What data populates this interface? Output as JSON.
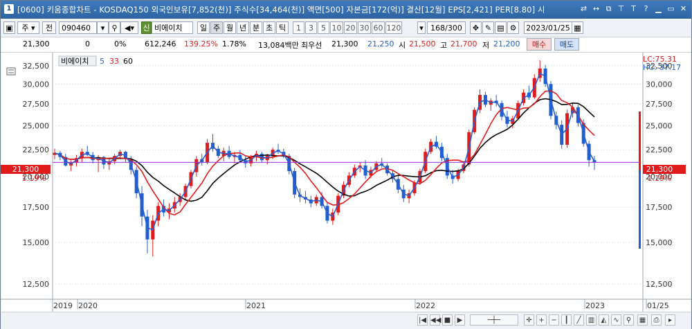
{
  "title": {
    "window_number": "1",
    "text": "[0600] 키움종합차트 - KOSDAQ150 외국인보유[7,852(천)] 주식수[34,464(천)] 액면[500] 자본금[172(억)] 결산[12월] EPS[2,421] PER[8.80] 시"
  },
  "toolbar": {
    "period_select": "주",
    "prev_label": "전",
    "code": "090460",
    "stock_badge": "신",
    "stock_name": "비에이치",
    "period_tabs": [
      "일",
      "주",
      "월",
      "년",
      "분",
      "초",
      "틱"
    ],
    "active_tab": "주",
    "num_tabs": [
      "1",
      "3",
      "5",
      "10",
      "20",
      "30",
      "60",
      "120"
    ],
    "count": "168",
    "count_total": "/300",
    "date": "2023/01/25"
  },
  "quote": {
    "price": "21,300",
    "change": "0",
    "change_pct": "0%",
    "volume": "612,246",
    "volume_ratio": "139.25%",
    "turnover": "1.78%",
    "amount": "13,084백만",
    "bid_label": "최우선",
    "bid1": "21,300",
    "bid2": "21,250",
    "open_label": "시",
    "open": "21,500",
    "high_label": "고",
    "high": "21,700",
    "low_label": "저",
    "low": "21,200",
    "buy_label": "매수",
    "sell_label": "매도"
  },
  "legend": {
    "name": "비에이치",
    "ma1": "5",
    "ma2": "33",
    "ma3": "60"
  },
  "right_labels": {
    "lc": "LC:75.31",
    "hc": "HC:-37.17",
    "price_tag": "21,300",
    "pct_tag": "1.19%"
  },
  "left_labels": {
    "price_tag": "21,300",
    "pct_tag": "1.19%"
  },
  "colors": {
    "ma5": "#2a5fd1",
    "ma33": "#e01b1b",
    "ma60": "#000000",
    "up": "#e01b1b",
    "down": "#1f5fd1",
    "line": "#9b2ad6"
  },
  "chart_data": {
    "type": "candlestick",
    "y_ticks": [
      "32,500",
      "30,000",
      "27,500",
      "25,000",
      "22,500",
      "20,000",
      "17,500",
      "15,000",
      "12,500"
    ],
    "y_values": [
      32500,
      30000,
      27500,
      25000,
      22500,
      20000,
      17500,
      15000,
      12500
    ],
    "x_labels": [
      "2019",
      "2020",
      "2021",
      "2022",
      "2023",
      "01/25"
    ],
    "current_price": 21300,
    "ohlc_weekly_approx": [
      [
        22000,
        22600,
        21600,
        22200
      ],
      [
        22200,
        22400,
        21500,
        21800
      ],
      [
        21800,
        22100,
        20900,
        21000
      ],
      [
        21000,
        21500,
        20500,
        21300
      ],
      [
        21300,
        22000,
        20900,
        21700
      ],
      [
        21700,
        22600,
        21300,
        22300
      ],
      [
        22300,
        22900,
        21900,
        22000
      ],
      [
        22000,
        22300,
        21200,
        21500
      ],
      [
        21500,
        22000,
        20400,
        21800
      ],
      [
        21800,
        21900,
        20700,
        21100
      ],
      [
        21100,
        21600,
        20600,
        21400
      ],
      [
        21400,
        22100,
        21100,
        21900
      ],
      [
        21900,
        22500,
        21600,
        22300
      ],
      [
        22300,
        22400,
        21300,
        21600
      ],
      [
        21600,
        21900,
        20200,
        20600
      ],
      [
        20600,
        20900,
        18200,
        18600
      ],
      [
        18600,
        19200,
        16100,
        16800
      ],
      [
        16800,
        17300,
        14300,
        15200
      ],
      [
        15200,
        16900,
        14100,
        16500
      ],
      [
        16500,
        17900,
        16100,
        17600
      ],
      [
        17600,
        18100,
        16800,
        17100
      ],
      [
        17100,
        17800,
        16600,
        17400
      ],
      [
        17400,
        18300,
        17100,
        17900
      ],
      [
        17900,
        18600,
        17600,
        18300
      ],
      [
        18300,
        19400,
        18000,
        19200
      ],
      [
        19200,
        20600,
        19000,
        20400
      ],
      [
        20400,
        21900,
        20000,
        21600
      ],
      [
        21600,
        22100,
        21000,
        21300
      ],
      [
        21300,
        23600,
        21100,
        23200
      ],
      [
        23200,
        24100,
        22300,
        22600
      ],
      [
        22600,
        22900,
        21700,
        21900
      ],
      [
        21900,
        22700,
        21400,
        22400
      ],
      [
        22400,
        22900,
        21600,
        21800
      ],
      [
        21800,
        22300,
        21200,
        22000
      ],
      [
        22000,
        22500,
        21300,
        21500
      ],
      [
        21500,
        21900,
        20800,
        21200
      ],
      [
        21200,
        22000,
        20900,
        21800
      ],
      [
        21800,
        22400,
        21400,
        22100
      ],
      [
        22100,
        22300,
        21300,
        21500
      ],
      [
        21500,
        22100,
        21100,
        21900
      ],
      [
        21900,
        22700,
        21600,
        22500
      ],
      [
        22500,
        23100,
        22100,
        22300
      ],
      [
        22300,
        22600,
        21700,
        21900
      ],
      [
        21900,
        22100,
        20200,
        20500
      ],
      [
        20500,
        20800,
        18200,
        18500
      ],
      [
        18500,
        19000,
        17900,
        18300
      ],
      [
        18300,
        18800,
        17800,
        18100
      ],
      [
        18100,
        18400,
        17500,
        17800
      ],
      [
        17800,
        18500,
        17600,
        18300
      ],
      [
        18300,
        18700,
        17400,
        17600
      ],
      [
        17600,
        17900,
        16300,
        16500
      ],
      [
        16500,
        17400,
        16200,
        17100
      ],
      [
        17100,
        18600,
        16900,
        18400
      ],
      [
        18400,
        19600,
        18200,
        19300
      ],
      [
        19300,
        20400,
        19100,
        20100
      ],
      [
        20100,
        21100,
        19900,
        20800
      ],
      [
        20800,
        21300,
        20400,
        21000
      ],
      [
        21000,
        21500,
        19800,
        20100
      ],
      [
        20100,
        20900,
        19900,
        20600
      ],
      [
        20600,
        21400,
        20400,
        21200
      ],
      [
        21200,
        21700,
        20800,
        21000
      ],
      [
        21000,
        21200,
        20100,
        20300
      ],
      [
        20300,
        20600,
        19500,
        19800
      ],
      [
        19800,
        20100,
        18600,
        18900
      ],
      [
        18900,
        19300,
        17900,
        18200
      ],
      [
        18200,
        18900,
        17800,
        18600
      ],
      [
        18600,
        19700,
        18400,
        19500
      ],
      [
        19500,
        20700,
        19300,
        20500
      ],
      [
        20500,
        22600,
        20300,
        22300
      ],
      [
        22300,
        23600,
        22100,
        23300
      ],
      [
        23300,
        23900,
        22600,
        22800
      ],
      [
        22800,
        23200,
        21400,
        21700
      ],
      [
        21700,
        22100,
        19800,
        20100
      ],
      [
        20100,
        20600,
        19400,
        19800
      ],
      [
        19800,
        20700,
        19600,
        20500
      ],
      [
        20500,
        21400,
        20300,
        21100
      ],
      [
        21100,
        24600,
        20900,
        24300
      ],
      [
        24300,
        27100,
        24100,
        26800
      ],
      [
        26800,
        29300,
        26400,
        28600
      ],
      [
        28600,
        29000,
        27100,
        27400
      ],
      [
        27400,
        28200,
        26700,
        27900
      ],
      [
        27900,
        28600,
        27200,
        27600
      ],
      [
        27600,
        27900,
        25600,
        26000
      ],
      [
        26000,
        26700,
        24800,
        25200
      ],
      [
        25200,
        26100,
        24700,
        25800
      ],
      [
        25800,
        27900,
        25600,
        27600
      ],
      [
        27600,
        29300,
        27300,
        28900
      ],
      [
        28900,
        29800,
        28000,
        28300
      ],
      [
        28300,
        31300,
        28100,
        30800
      ],
      [
        30800,
        33300,
        30300,
        32100
      ],
      [
        32100,
        32600,
        29600,
        30000
      ],
      [
        30000,
        30400,
        25700,
        26100
      ],
      [
        26100,
        26600,
        24600,
        25100
      ],
      [
        25100,
        25600,
        22600,
        23000
      ],
      [
        23000,
        26800,
        22700,
        26400
      ],
      [
        26400,
        27600,
        25900,
        27100
      ],
      [
        27100,
        27400,
        24900,
        25300
      ],
      [
        25300,
        25700,
        22800,
        23100
      ],
      [
        23100,
        23400,
        20900,
        21500
      ],
      [
        21500,
        21900,
        20600,
        21300
      ]
    ]
  }
}
